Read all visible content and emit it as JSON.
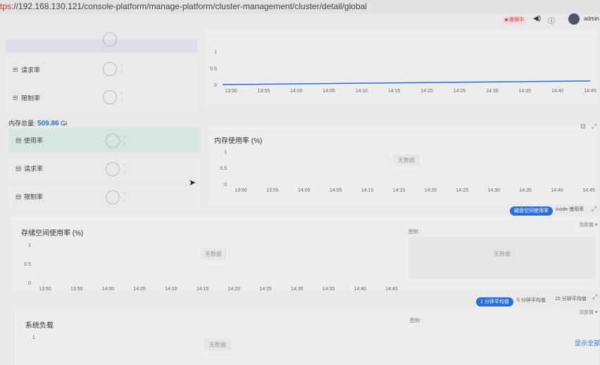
{
  "browser": {
    "url_scheme": "tps:",
    "url_rest": "//192.168.130.121/console-platform/manage-platform/cluster-management/cluster/detail/global"
  },
  "header": {
    "status_label": "维保中",
    "volume_icon": "speaker-icon",
    "help_icon": "question-icon",
    "username": "admin"
  },
  "cpu_section": {
    "rows": [
      {
        "label": "请求率",
        "value_top": "-",
        "value_bottom": "-"
      },
      {
        "label": "限制率",
        "value_top": "-",
        "value_bottom": "-"
      }
    ]
  },
  "cpu_chart": {
    "y_ticks": [
      "1",
      "0.5",
      "0"
    ],
    "x_ticks": [
      "13:50",
      "13:55",
      "14:00",
      "14:05",
      "14:10",
      "14:15",
      "14:20",
      "14:25",
      "14:30",
      "14:35",
      "14:40",
      "14:45"
    ]
  },
  "memory_section": {
    "total_label": "内存总量:",
    "total_value": "509.86",
    "total_unit": "Gi",
    "rows": [
      {
        "label": "使用率",
        "value_top": "-",
        "value_bottom": "-"
      },
      {
        "label": "请求率",
        "value_top": "-",
        "value_bottom": "-"
      },
      {
        "label": "限制率",
        "value_top": "-",
        "value_bottom": "-"
      }
    ]
  },
  "memory_chart": {
    "title": "内存使用率 (%)",
    "no_data": "无数据",
    "y_ticks": [
      "1",
      "0.5",
      "0"
    ],
    "x_ticks": [
      "13:50",
      "13:55",
      "14:00",
      "14:05",
      "14:10",
      "14:15",
      "14:20",
      "14:25",
      "14:30",
      "14:35",
      "14:40",
      "14:45"
    ]
  },
  "storage_toggle": {
    "active": "磁盘空间使用率",
    "inactive": "inode 使用率"
  },
  "storage_chart": {
    "title": "存储空间使用率 (%)",
    "no_data": "无数据",
    "legend_label": "图例 :",
    "sort_label": "当前值 ▾",
    "y_ticks": [
      "1",
      "0.5",
      "0"
    ],
    "x_ticks": [
      "13:50",
      "13:55",
      "14:00",
      "14:05",
      "14:10",
      "14:15",
      "14:20",
      "14:25",
      "14:30",
      "14:35",
      "14:40",
      "14:45"
    ]
  },
  "load_toggle": {
    "active": "1 分钟平均值",
    "opt2": "5 分钟平均值",
    "opt3": "15 分钟平均值"
  },
  "load_chart": {
    "title": "系统负载",
    "no_data": "无数据",
    "legend_label": "图例 :",
    "sort_label": "当前值 ▾",
    "y_tick": "1",
    "show_all": "显示全部"
  },
  "chart_data": [
    {
      "type": "line",
      "title": "",
      "x": [
        "13:50",
        "13:55",
        "14:00",
        "14:05",
        "14:10",
        "14:15",
        "14:20",
        "14:25",
        "14:30",
        "14:35",
        "14:40",
        "14:45"
      ],
      "series": [
        {
          "values": [
            0.02,
            0.03,
            0.04,
            0.05,
            0.06,
            0.07,
            0.08,
            0.09,
            0.1,
            0.11,
            0.12,
            0.13
          ]
        }
      ],
      "ylim": [
        0,
        1
      ]
    },
    {
      "type": "line",
      "title": "内存使用率 (%)",
      "x": [
        "13:50",
        "13:55",
        "14:00",
        "14:05",
        "14:10",
        "14:15",
        "14:20",
        "14:25",
        "14:30",
        "14:35",
        "14:40",
        "14:45"
      ],
      "series": [],
      "ylim": [
        0,
        1
      ]
    },
    {
      "type": "line",
      "title": "存储空间使用率 (%)",
      "x": [
        "13:50",
        "13:55",
        "14:00",
        "14:05",
        "14:10",
        "14:15",
        "14:20",
        "14:25",
        "14:30",
        "14:35",
        "14:40",
        "14:45"
      ],
      "series": [],
      "ylim": [
        0,
        1
      ]
    }
  ]
}
